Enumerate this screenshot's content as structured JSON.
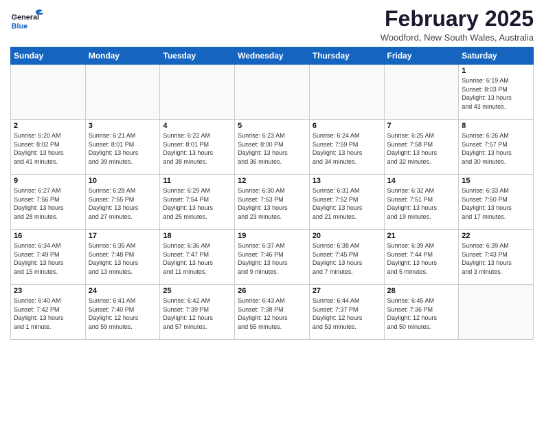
{
  "header": {
    "logo_line1": "General",
    "logo_line2": "Blue",
    "month_title": "February 2025",
    "location": "Woodford, New South Wales, Australia"
  },
  "weekdays": [
    "Sunday",
    "Monday",
    "Tuesday",
    "Wednesday",
    "Thursday",
    "Friday",
    "Saturday"
  ],
  "weeks": [
    [
      {
        "day": "",
        "info": ""
      },
      {
        "day": "",
        "info": ""
      },
      {
        "day": "",
        "info": ""
      },
      {
        "day": "",
        "info": ""
      },
      {
        "day": "",
        "info": ""
      },
      {
        "day": "",
        "info": ""
      },
      {
        "day": "1",
        "info": "Sunrise: 6:19 AM\nSunset: 8:03 PM\nDaylight: 13 hours\nand 43 minutes."
      }
    ],
    [
      {
        "day": "2",
        "info": "Sunrise: 6:20 AM\nSunset: 8:02 PM\nDaylight: 13 hours\nand 41 minutes."
      },
      {
        "day": "3",
        "info": "Sunrise: 6:21 AM\nSunset: 8:01 PM\nDaylight: 13 hours\nand 39 minutes."
      },
      {
        "day": "4",
        "info": "Sunrise: 6:22 AM\nSunset: 8:01 PM\nDaylight: 13 hours\nand 38 minutes."
      },
      {
        "day": "5",
        "info": "Sunrise: 6:23 AM\nSunset: 8:00 PM\nDaylight: 13 hours\nand 36 minutes."
      },
      {
        "day": "6",
        "info": "Sunrise: 6:24 AM\nSunset: 7:59 PM\nDaylight: 13 hours\nand 34 minutes."
      },
      {
        "day": "7",
        "info": "Sunrise: 6:25 AM\nSunset: 7:58 PM\nDaylight: 13 hours\nand 32 minutes."
      },
      {
        "day": "8",
        "info": "Sunrise: 6:26 AM\nSunset: 7:57 PM\nDaylight: 13 hours\nand 30 minutes."
      }
    ],
    [
      {
        "day": "9",
        "info": "Sunrise: 6:27 AM\nSunset: 7:56 PM\nDaylight: 13 hours\nand 28 minutes."
      },
      {
        "day": "10",
        "info": "Sunrise: 6:28 AM\nSunset: 7:55 PM\nDaylight: 13 hours\nand 27 minutes."
      },
      {
        "day": "11",
        "info": "Sunrise: 6:29 AM\nSunset: 7:54 PM\nDaylight: 13 hours\nand 25 minutes."
      },
      {
        "day": "12",
        "info": "Sunrise: 6:30 AM\nSunset: 7:53 PM\nDaylight: 13 hours\nand 23 minutes."
      },
      {
        "day": "13",
        "info": "Sunrise: 6:31 AM\nSunset: 7:52 PM\nDaylight: 13 hours\nand 21 minutes."
      },
      {
        "day": "14",
        "info": "Sunrise: 6:32 AM\nSunset: 7:51 PM\nDaylight: 13 hours\nand 19 minutes."
      },
      {
        "day": "15",
        "info": "Sunrise: 6:33 AM\nSunset: 7:50 PM\nDaylight: 13 hours\nand 17 minutes."
      }
    ],
    [
      {
        "day": "16",
        "info": "Sunrise: 6:34 AM\nSunset: 7:49 PM\nDaylight: 13 hours\nand 15 minutes."
      },
      {
        "day": "17",
        "info": "Sunrise: 6:35 AM\nSunset: 7:48 PM\nDaylight: 13 hours\nand 13 minutes."
      },
      {
        "day": "18",
        "info": "Sunrise: 6:36 AM\nSunset: 7:47 PM\nDaylight: 13 hours\nand 11 minutes."
      },
      {
        "day": "19",
        "info": "Sunrise: 6:37 AM\nSunset: 7:46 PM\nDaylight: 13 hours\nand 9 minutes."
      },
      {
        "day": "20",
        "info": "Sunrise: 6:38 AM\nSunset: 7:45 PM\nDaylight: 13 hours\nand 7 minutes."
      },
      {
        "day": "21",
        "info": "Sunrise: 6:39 AM\nSunset: 7:44 PM\nDaylight: 13 hours\nand 5 minutes."
      },
      {
        "day": "22",
        "info": "Sunrise: 6:39 AM\nSunset: 7:43 PM\nDaylight: 13 hours\nand 3 minutes."
      }
    ],
    [
      {
        "day": "23",
        "info": "Sunrise: 6:40 AM\nSunset: 7:42 PM\nDaylight: 13 hours\nand 1 minute."
      },
      {
        "day": "24",
        "info": "Sunrise: 6:41 AM\nSunset: 7:40 PM\nDaylight: 12 hours\nand 59 minutes."
      },
      {
        "day": "25",
        "info": "Sunrise: 6:42 AM\nSunset: 7:39 PM\nDaylight: 12 hours\nand 57 minutes."
      },
      {
        "day": "26",
        "info": "Sunrise: 6:43 AM\nSunset: 7:38 PM\nDaylight: 12 hours\nand 55 minutes."
      },
      {
        "day": "27",
        "info": "Sunrise: 6:44 AM\nSunset: 7:37 PM\nDaylight: 12 hours\nand 53 minutes."
      },
      {
        "day": "28",
        "info": "Sunrise: 6:45 AM\nSunset: 7:36 PM\nDaylight: 12 hours\nand 50 minutes."
      },
      {
        "day": "",
        "info": ""
      }
    ]
  ]
}
